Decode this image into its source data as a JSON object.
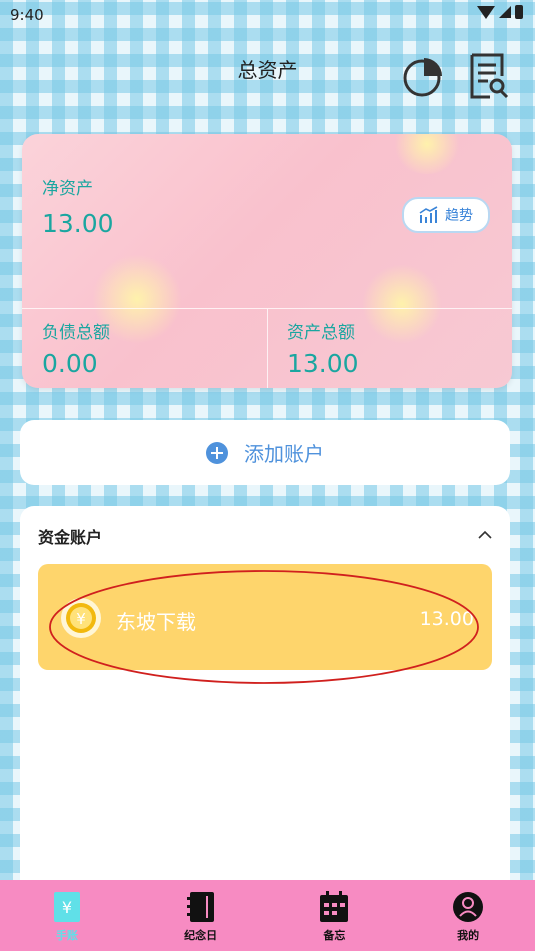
{
  "status_bar": {
    "time": "9:40"
  },
  "header": {
    "title": "总资产",
    "pie_icon": "pie-chart-icon",
    "report_icon": "report-search-icon"
  },
  "summary": {
    "net_label": "净资产",
    "net_value": "13.00",
    "trend_label": "趋势",
    "debt_label": "负债总额",
    "debt_value": "0.00",
    "total_label": "资产总额",
    "total_value": "13.00"
  },
  "add_account": {
    "label": "添加账户"
  },
  "funds": {
    "title": "资金账户",
    "accounts": [
      {
        "name": "东坡下载",
        "amount": "13.00",
        "icon": "yuan-coin-icon",
        "color": "#fed56c"
      }
    ]
  },
  "nav": {
    "items": [
      {
        "label": "手账",
        "icon": "yuan-book-icon",
        "active": true
      },
      {
        "label": "纪念日",
        "icon": "notebook-icon",
        "active": false
      },
      {
        "label": "备忘",
        "icon": "calendar-icon",
        "active": false
      },
      {
        "label": "我的",
        "icon": "user-icon",
        "active": false
      }
    ]
  },
  "colors": {
    "accent_teal": "#1aa6a0",
    "accent_blue": "#4f92dc",
    "nav_pink": "#f78bc2",
    "account_yellow": "#fed56c"
  }
}
